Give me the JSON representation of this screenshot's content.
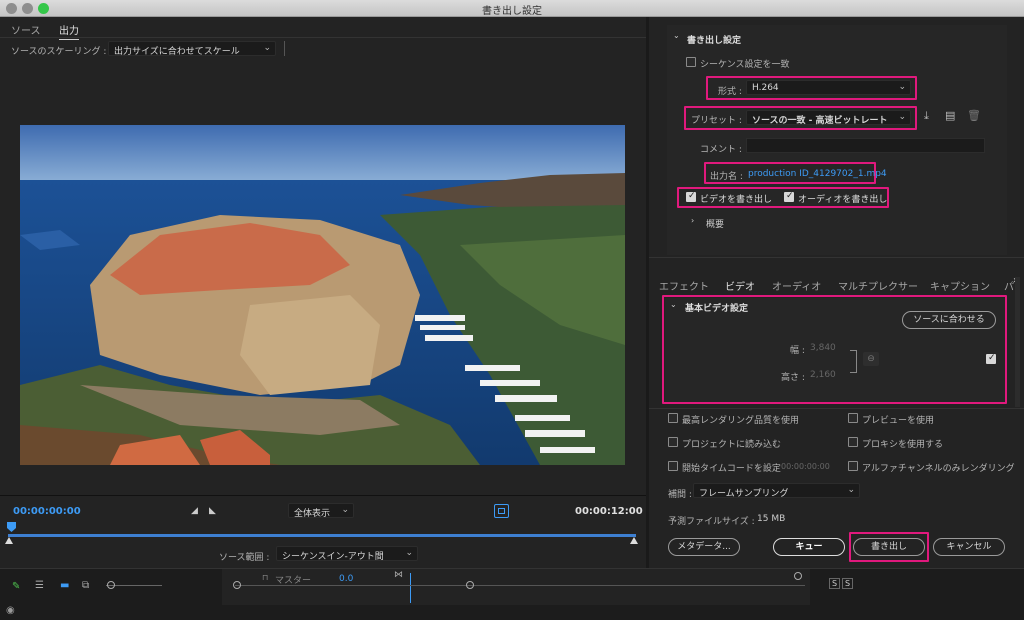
{
  "window": {
    "title": "書き出し設定"
  },
  "left": {
    "tabs": [
      "ソース",
      "出力"
    ],
    "scaling_label": "ソースのスケーリング :",
    "scaling_value": "出力サイズに合わせてスケール",
    "timecode_start": "00:00:00:00",
    "timecode_end": "00:00:12:00",
    "zoom_value": "全体表示",
    "source_range_label": "ソース範囲 :",
    "source_range_value": "シーケンスイン-アウト間"
  },
  "export": {
    "section_title": "書き出し設定",
    "match_sequence_label": "シーケンス設定を一致",
    "format_label": "形式 :",
    "format_value": "H.264",
    "preset_label": "プリセット :",
    "preset_value": "ソースの一致 - 高速ビットレート",
    "comment_label": "コメント :",
    "output_name_label": "出力名 :",
    "output_name_value": "production ID_4129702_1.mp4",
    "export_video_label": "ビデオを書き出し",
    "export_audio_label": "オーディオを書き出し",
    "summary_label": "概要"
  },
  "tabs": [
    "エフェクト",
    "ビデオ",
    "オーディオ",
    "マルチプレクサー",
    "キャプション",
    "パ"
  ],
  "basic_video": {
    "title": "基本ビデオ設定",
    "match_source_button": "ソースに合わせる",
    "width_label": "幅 :",
    "width_value": "3,840",
    "height_label": "高さ :",
    "height_value": "2,160"
  },
  "options": {
    "max_render_quality": "最高レンダリング品質を使用",
    "use_previews": "プレビューを使用",
    "import_into_project": "プロジェクトに読み込む",
    "use_proxies": "プロキシを使用する",
    "set_start_timecode": "開始タイムコードを設定",
    "start_timecode_value": "00:00:00:00",
    "render_alpha_only": "アルファチャンネルのみレンダリング",
    "interpolation_label": "補間 :",
    "interpolation_value": "フレームサンプリング",
    "estimated_size_label": "予測ファイルサイズ :",
    "estimated_size_value": "15 MB"
  },
  "buttons": {
    "metadata": "メタデータ...",
    "queue": "キュー",
    "export": "書き出し",
    "cancel": "キャンセル"
  },
  "bottom": {
    "master_label": "マスター",
    "master_value": "0.0",
    "s_label": "S"
  },
  "colors": {
    "accent_blue": "#3d9bf5",
    "highlight_pink": "#e0197d",
    "panel_bg": "#232323"
  }
}
